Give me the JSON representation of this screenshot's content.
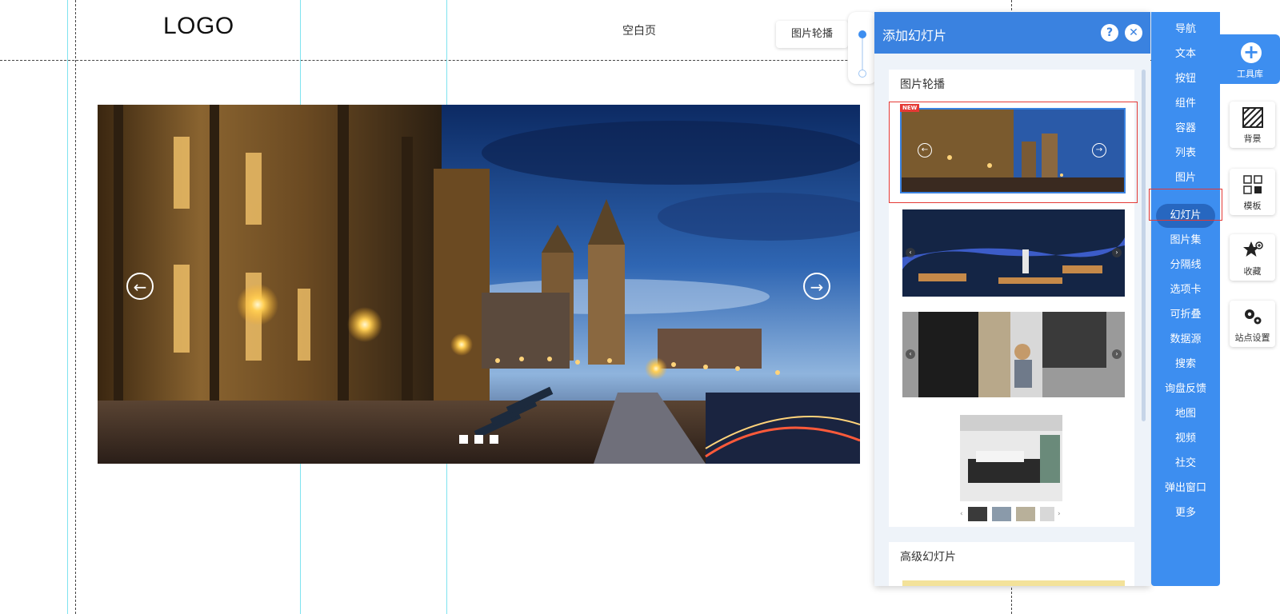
{
  "header": {
    "logo": "LOGO",
    "page_label": "空白页"
  },
  "floating_tag": {
    "label": "图片轮播"
  },
  "slideshow": {
    "prev_icon": "arrow-left-icon",
    "next_icon": "arrow-right-icon",
    "dots": 3
  },
  "panel": {
    "title": "添加幻灯片",
    "help_label": "?",
    "close_label": "✕",
    "section1_title": "图片轮播",
    "new_badge": "NEW",
    "section2_title": "高级幻灯片"
  },
  "nav": {
    "items": [
      "导航",
      "文本",
      "按钮",
      "组件",
      "容器",
      "列表",
      "图片",
      "幻灯片",
      "图片集",
      "分隔线",
      "选项卡",
      "可折叠",
      "数据源",
      "搜索",
      "询盘反馈",
      "地图",
      "视频",
      "社交",
      "弹出窗口",
      "更多"
    ],
    "active": "幻灯片"
  },
  "toolbox": {
    "label": "工具库",
    "icon": "plus-circle-icon"
  },
  "side_buttons": [
    {
      "label": "背景",
      "icon": "background-icon"
    },
    {
      "label": "模板",
      "icon": "template-icon"
    },
    {
      "label": "收藏",
      "icon": "star-icon"
    },
    {
      "label": "站点设置",
      "icon": "gear-icon"
    }
  ],
  "colors": {
    "accent": "#3d8ef0",
    "panel_header": "#3a82e0",
    "highlight_border": "#e53935"
  }
}
